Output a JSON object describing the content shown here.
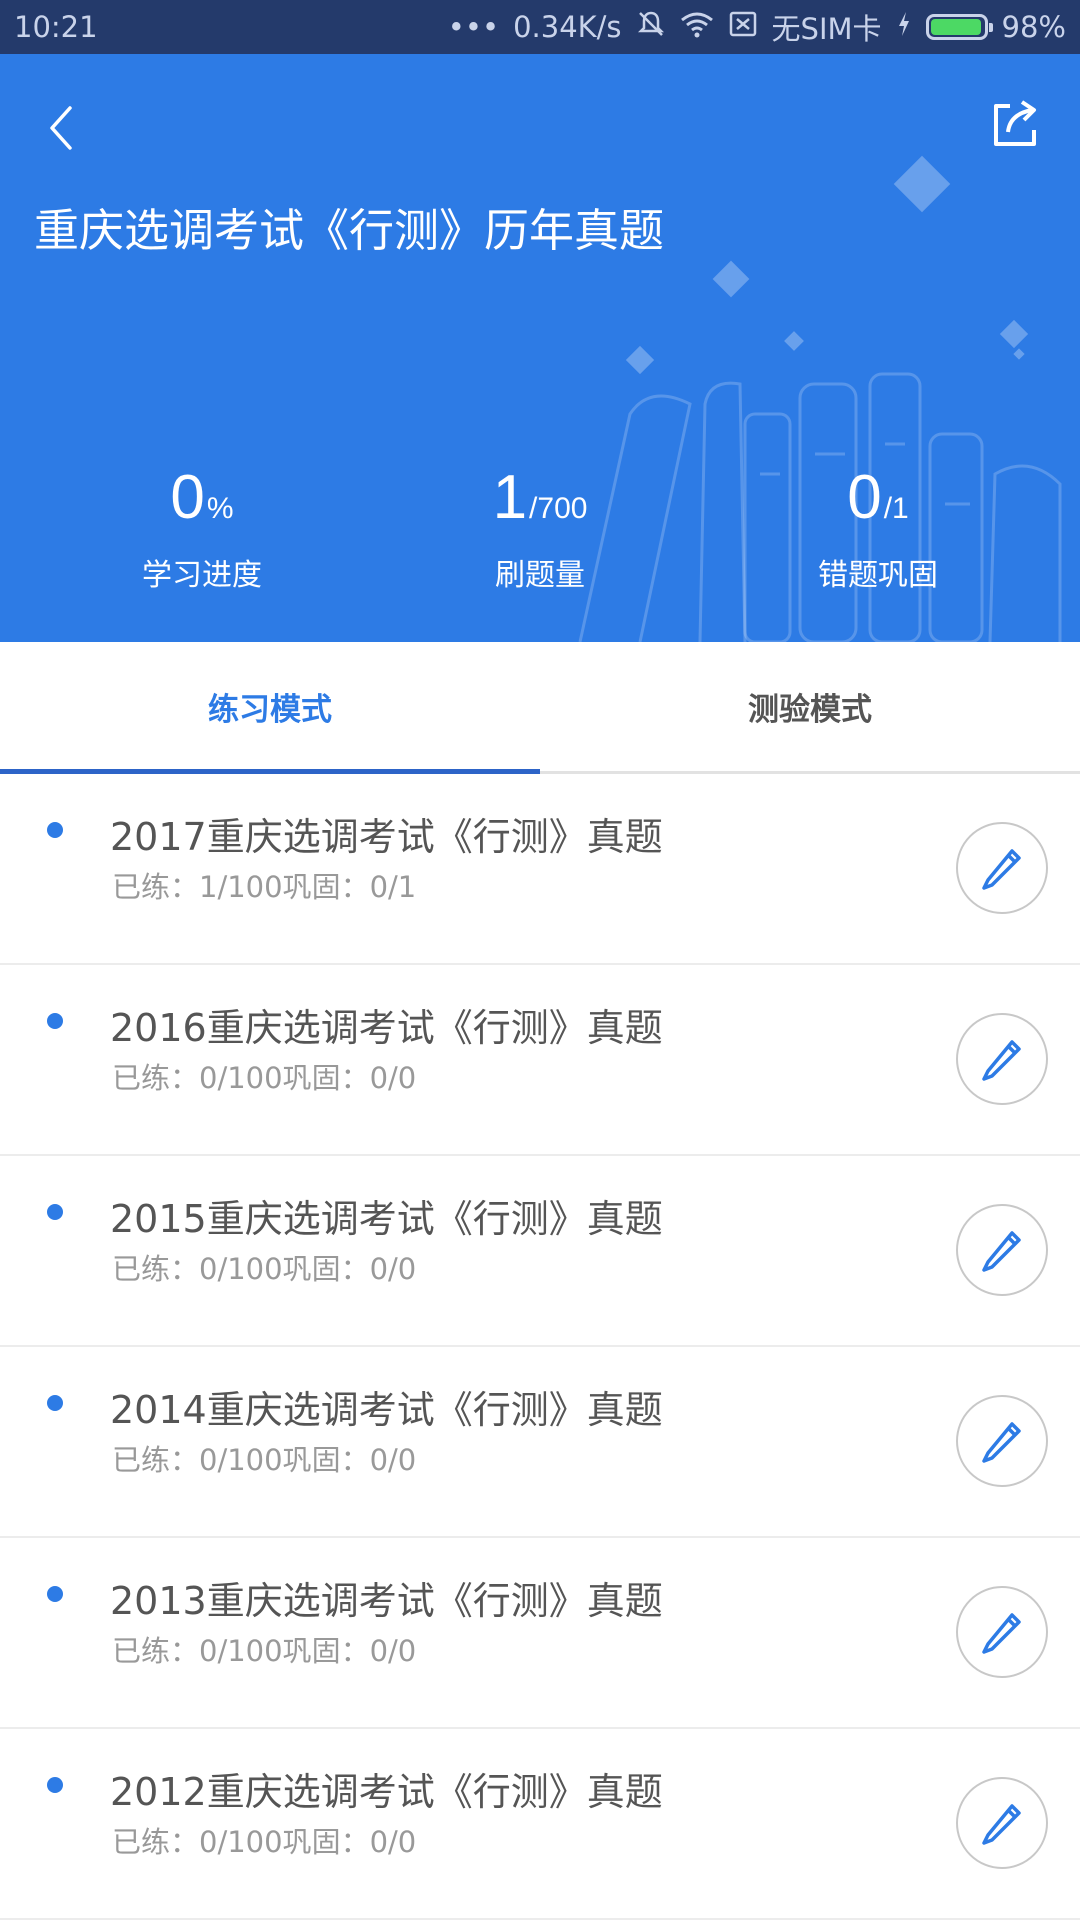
{
  "status_bar": {
    "time": "10:21",
    "dots": "•••",
    "speed": "0.34K/s",
    "sim": "无SIM卡",
    "battery": "98%",
    "battery_level": 0.98
  },
  "header": {
    "title": "重庆选调考试《行测》历年真题",
    "background_color": "#2d7be5"
  },
  "stats": [
    {
      "value": "0",
      "unit": "%",
      "label": "学习进度"
    },
    {
      "value": "1",
      "unit": "/700",
      "label": "刷题量"
    },
    {
      "value": "0",
      "unit": "/1",
      "label": "错题巩固"
    }
  ],
  "tabs": [
    {
      "label": "练习模式",
      "active": true
    },
    {
      "label": "测验模式",
      "active": false
    }
  ],
  "items": [
    {
      "title": "2017重庆选调考试《行测》真题",
      "meta": "已练：1/100巩固：0/1"
    },
    {
      "title": "2016重庆选调考试《行测》真题",
      "meta": "已练：0/100巩固：0/0"
    },
    {
      "title": "2015重庆选调考试《行测》真题",
      "meta": "已练：0/100巩固：0/0"
    },
    {
      "title": "2014重庆选调考试《行测》真题",
      "meta": "已练：0/100巩固：0/0"
    },
    {
      "title": "2013重庆选调考试《行测》真题",
      "meta": "已练：0/100巩固：0/0"
    },
    {
      "title": "2012重庆选调考试《行测》真题",
      "meta": "已练：0/100巩固：0/0"
    }
  ],
  "icons": {
    "back": "chevron-left-icon",
    "share": "share-icon",
    "edit": "pencil-icon"
  },
  "colors": {
    "accent": "#2d7be5",
    "status_bar": "#243a6b"
  }
}
